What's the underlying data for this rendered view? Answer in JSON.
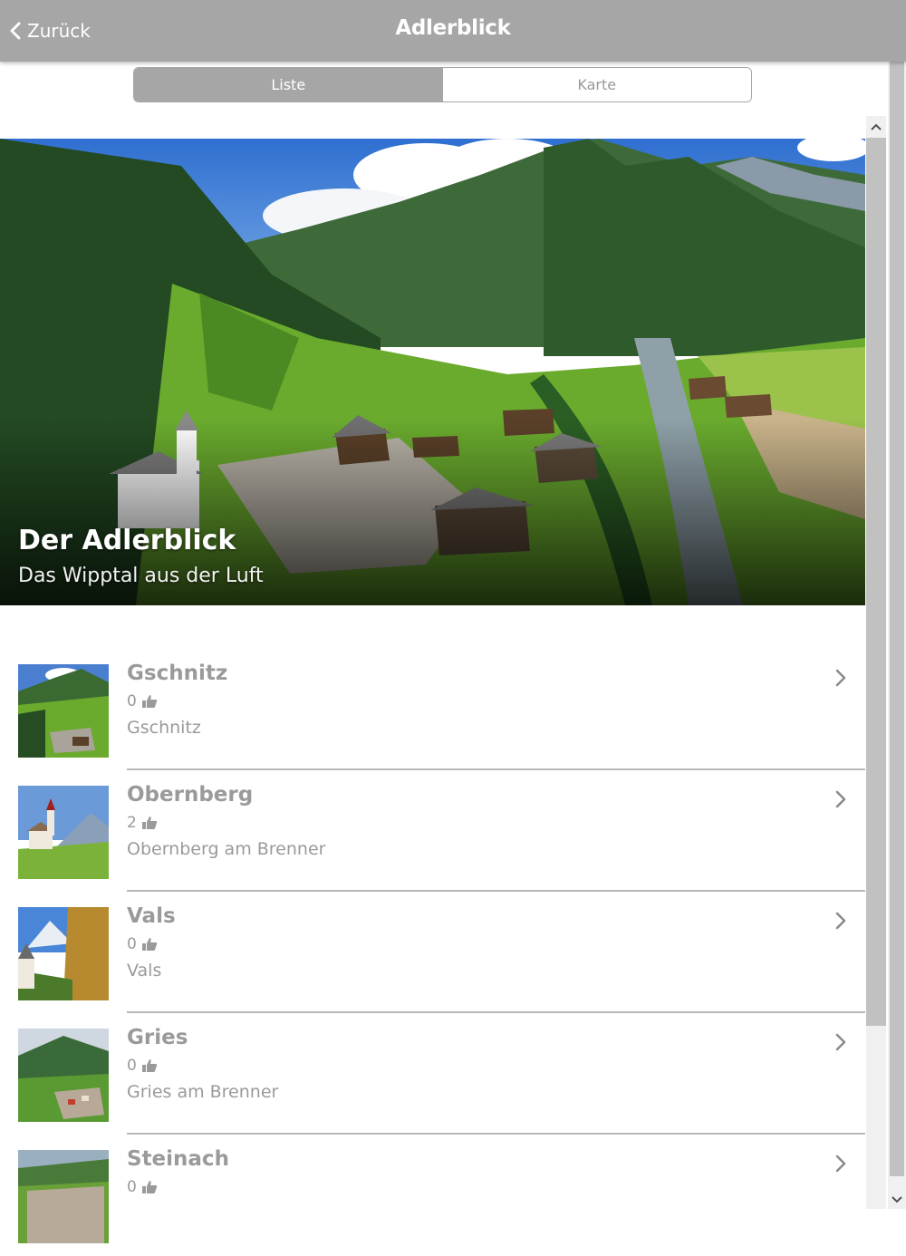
{
  "header": {
    "back_label": "Zurück",
    "title": "Adlerblick"
  },
  "tabs": [
    {
      "label": "Liste",
      "active": true
    },
    {
      "label": "Karte",
      "active": false
    }
  ],
  "hero": {
    "title": "Der Adlerblick",
    "subtitle": "Das Wipptal aus der Luft"
  },
  "items": [
    {
      "name": "Gschnitz",
      "likes": "0",
      "place": "Gschnitz"
    },
    {
      "name": "Obernberg",
      "likes": "2",
      "place": "Obernberg am Brenner"
    },
    {
      "name": "Vals",
      "likes": "0",
      "place": "Vals"
    },
    {
      "name": "Gries",
      "likes": "0",
      "place": "Gries am Brenner"
    },
    {
      "name": "Steinach",
      "likes": "0",
      "place": ""
    }
  ],
  "colors": {
    "header_bg": "#a6a6a6",
    "text_gray": "#9a9a9a",
    "divider": "#b8b8b8"
  },
  "icons": {
    "back": "chevron-left-icon",
    "like": "thumbs-up-icon",
    "row_arrow": "chevron-right-icon"
  }
}
